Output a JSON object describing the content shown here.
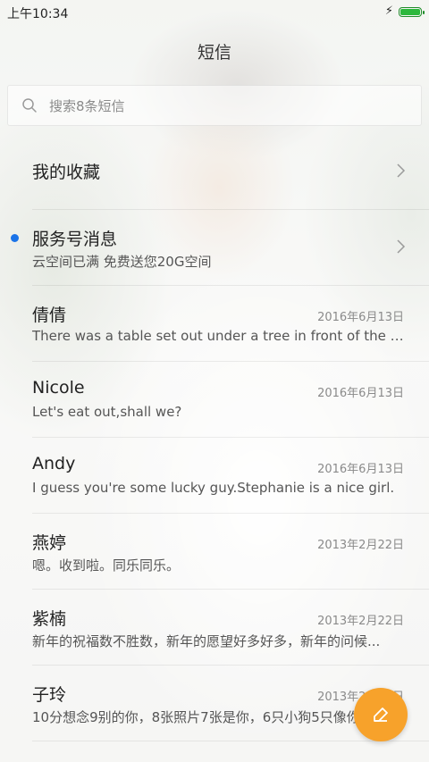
{
  "status_bar": {
    "time": "上午10:34",
    "battery_level_pct": 100
  },
  "header": {
    "title": "短信"
  },
  "search": {
    "placeholder": "搜索8条短信"
  },
  "conversations": [
    {
      "name": "我的收藏",
      "preview": "",
      "date": "",
      "has_chevron": true,
      "unread": false
    },
    {
      "name": "服务号消息",
      "preview": "云空间已满 免费送您20G空间",
      "date": "",
      "has_chevron": true,
      "unread": true
    },
    {
      "name": "倩倩",
      "preview": "There was a table set out under a tree in front of the ho...",
      "date": "2016年6月13日",
      "has_chevron": false,
      "unread": false
    },
    {
      "name": "Nicole",
      "preview": "Let's eat out,shall we?",
      "date": "2016年6月13日",
      "has_chevron": false,
      "unread": false
    },
    {
      "name": "Andy",
      "preview": "I guess you're some lucky guy.Stephanie is a nice girl.",
      "date": "2016年6月13日",
      "has_chevron": false,
      "unread": false
    },
    {
      "name": "燕婷",
      "preview": "嗯。收到啦。同乐同乐。",
      "date": "2013年2月22日",
      "has_chevron": false,
      "unread": false
    },
    {
      "name": "紫楠",
      "preview": "新年的祝福数不胜数，新年的愿望好多好多，新年的问候...",
      "date": "2013年2月22日",
      "has_chevron": false,
      "unread": false
    },
    {
      "name": "子玲",
      "preview": "10分想念9别的你，8张照片7张是你，6只小狗5只像你",
      "date": "2013年2月22日",
      "has_chevron": false,
      "unread": false
    }
  ],
  "fab": {
    "icon": "compose-icon",
    "color": "#f7a22b"
  },
  "colors": {
    "accent": "#f7a22b",
    "unread_dot": "#1a73e8",
    "battery": "#2db83d"
  }
}
